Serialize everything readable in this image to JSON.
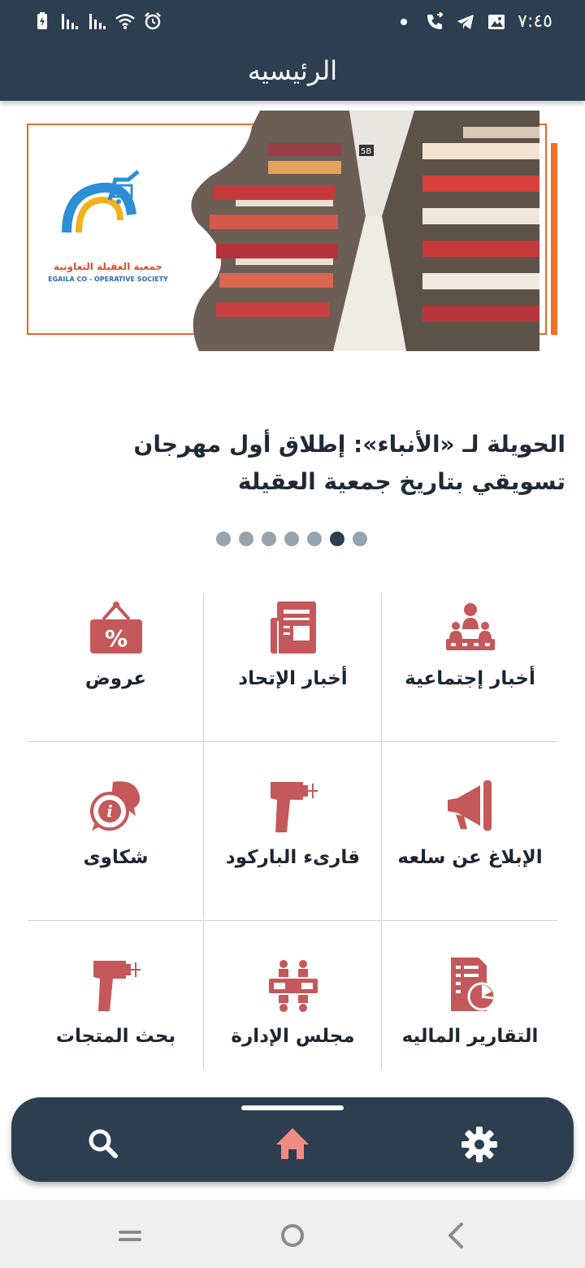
{
  "status_bar": {
    "time": "٧:٤٥",
    "left_icons": [
      "battery-charging-icon",
      "signal-icon",
      "signal-icon",
      "wifi-icon",
      "alarm-icon"
    ],
    "right_icons": [
      "dot-icon",
      "call-icon",
      "telegram-icon",
      "image-icon"
    ]
  },
  "app_bar": {
    "title": "الرئيسيه"
  },
  "banner": {
    "logo_text_ar": "جمعية العقيلة التعاونية",
    "logo_text_en": "EGAILA CO - OPERATIVE SOCIETY",
    "photo_label": "5B"
  },
  "headline": "الحويلة لـ «الأنباء»: إطلاق أول مهرجان تسويقي بتاريخ جمعية العقيلة",
  "carousel": {
    "total": 7,
    "active_index": 5
  },
  "menu": [
    {
      "label": "أخبار إجتماعية",
      "icon": "social-news-icon"
    },
    {
      "label": "أخبار الإتحاد",
      "icon": "newspaper-icon"
    },
    {
      "label": "عروض",
      "icon": "offers-tag-icon"
    },
    {
      "label": "الإبلاغ عن سلعه",
      "icon": "megaphone-icon"
    },
    {
      "label": "قارىء الباركود",
      "icon": "barcode-scanner-icon"
    },
    {
      "label": "شكاوى",
      "icon": "complaints-chat-icon"
    },
    {
      "label": "التقارير الماليه",
      "icon": "financial-report-icon"
    },
    {
      "label": "مجلس الإدارة",
      "icon": "board-meeting-icon"
    },
    {
      "label": "بحث المتجات",
      "icon": "product-search-scanner-icon"
    }
  ],
  "colors": {
    "primary": "#2d3e50",
    "accent": "#c4585a",
    "home_active": "#f28b82",
    "divider": "#c9d0d6"
  },
  "bottom_nav": [
    "settings-icon",
    "home-icon",
    "search-icon"
  ]
}
